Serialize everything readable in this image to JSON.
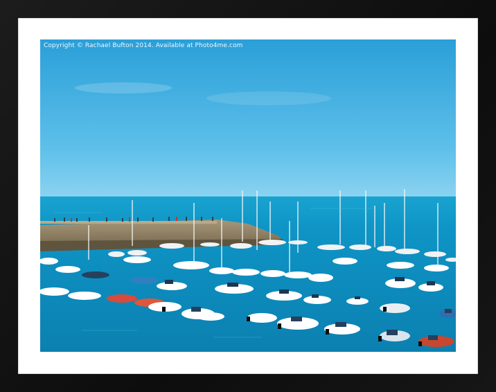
{
  "photo": {
    "watermark": "Copyright © Rachael Bufton 2014. Available at Photo4me.com",
    "subject": "harbour-with-moored-boats",
    "colors": {
      "frame": "#141414",
      "mount": "#ffffff",
      "sky_top": "#2b9ed6",
      "sky_horizon": "#7fcdee",
      "sea": "#0c93c4",
      "sea_deep": "#0a6f98",
      "pier_stone": "#8a7b5e"
    }
  }
}
